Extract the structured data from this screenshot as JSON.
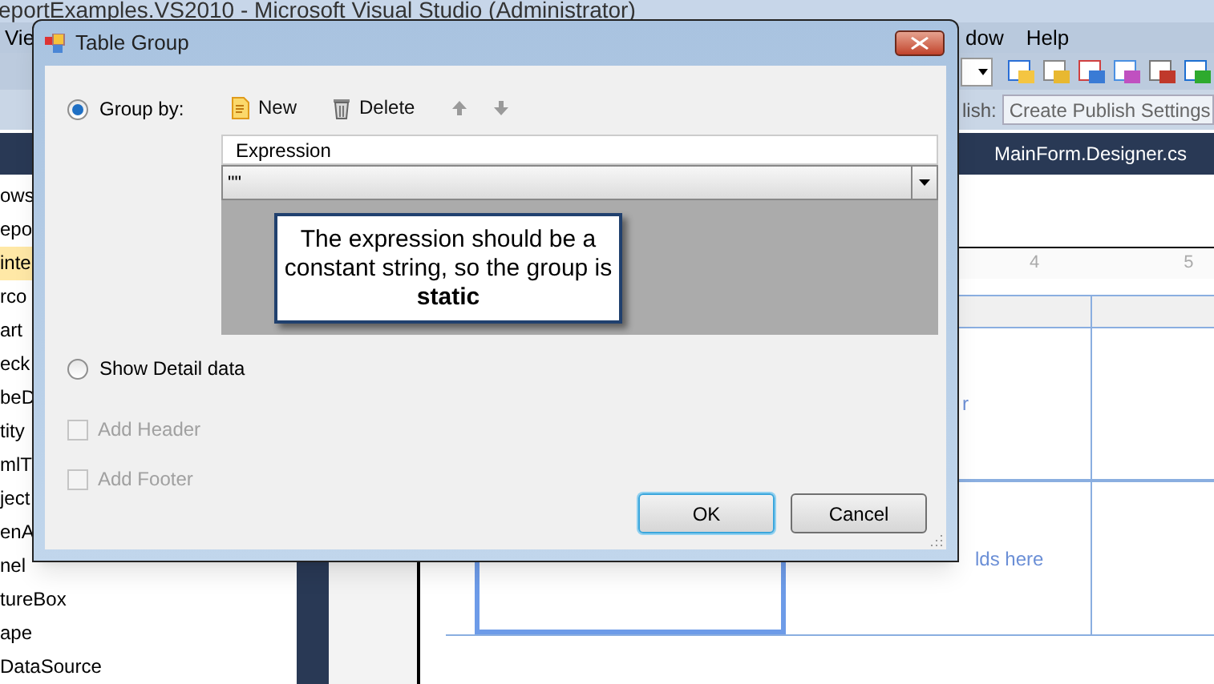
{
  "background_window": {
    "title": "eportExamples.VS2010 - Microsoft Visual Studio (Administrator)",
    "menu_left": "Vie",
    "menu_right": [
      "dow",
      "Help"
    ],
    "publish_label": "lish:",
    "publish_field": "Create Publish Settings",
    "document_tab": "MainForm.Designer.cs",
    "toolbox_items": [
      {
        "label": "ows",
        "selected": false
      },
      {
        "label": "epo",
        "selected": false
      },
      {
        "label": "inte",
        "selected": true
      },
      {
        "label": "rco",
        "selected": false
      },
      {
        "label": "art",
        "selected": false
      },
      {
        "label": "eck",
        "selected": false
      },
      {
        "label": "beD",
        "selected": false
      },
      {
        "label": "tity",
        "selected": false
      },
      {
        "label": "mlT",
        "selected": false
      },
      {
        "label": "ject",
        "selected": false
      },
      {
        "label": "enA",
        "selected": false
      },
      {
        "label": "nel",
        "selected": false
      },
      {
        "label": "tureBox",
        "selected": false
      },
      {
        "label": "ape",
        "selected": false
      },
      {
        "label": "DataSource",
        "selected": false
      }
    ],
    "ruler_labels": [
      "4",
      "5"
    ],
    "designer_texts": [
      "r",
      "lds here"
    ]
  },
  "dialog": {
    "title": "Table Group",
    "options": [
      {
        "label": "Group by:",
        "selected": true
      },
      {
        "label": "Show Detail data",
        "selected": false
      }
    ],
    "toolbar": [
      {
        "kind": "new",
        "label": "New",
        "disabled": false
      },
      {
        "kind": "delete",
        "label": "Delete",
        "disabled": false
      },
      {
        "kind": "up",
        "disabled": true
      },
      {
        "kind": "down",
        "disabled": true
      }
    ],
    "grid": {
      "columns": [
        "Expression"
      ],
      "rows": [
        "\"\""
      ]
    },
    "callout": "The expression should be a constant string, so the group is **static**",
    "checkboxes": [
      {
        "label": "Add Header",
        "checked": false,
        "disabled": true
      },
      {
        "label": "Add Footer",
        "checked": false,
        "disabled": true
      }
    ],
    "buttons": [
      {
        "label": "OK",
        "focused": true
      },
      {
        "label": "Cancel",
        "focused": false
      }
    ]
  }
}
